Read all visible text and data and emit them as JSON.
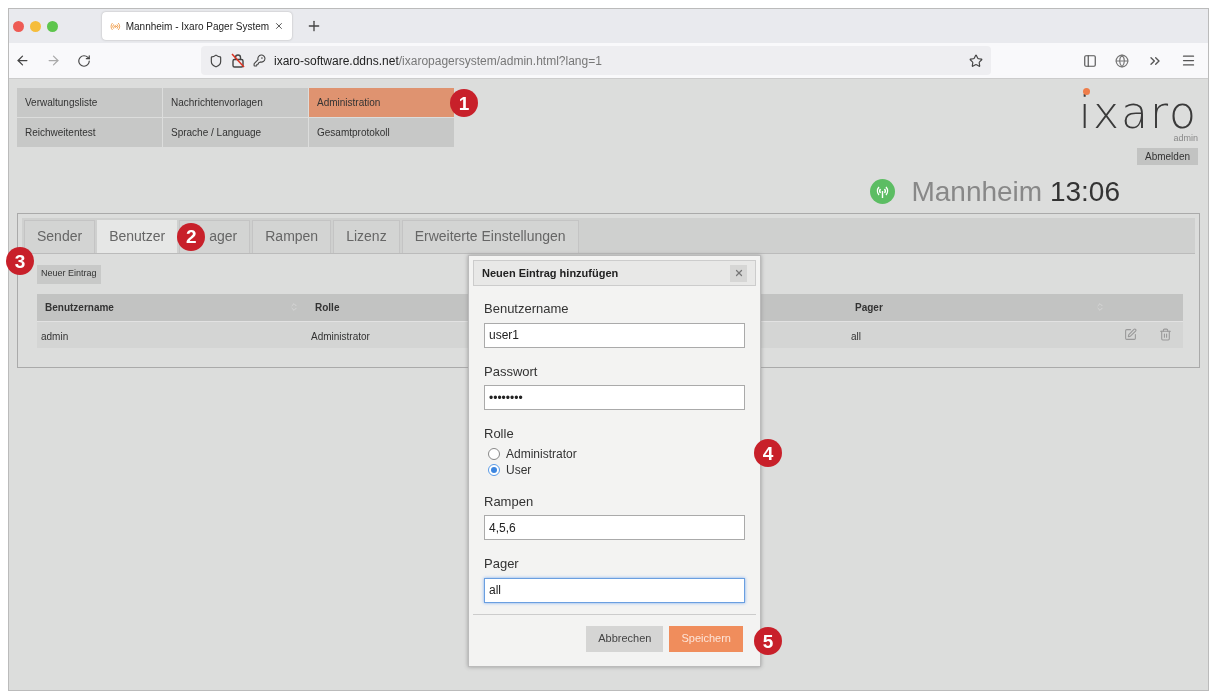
{
  "browser": {
    "tab_title": "Mannheim - Ixaro Pager System",
    "url_host": "ixaro-software.ddns.net",
    "url_path": "/ixaropagersystem/admin.html?lang=1"
  },
  "menu": [
    {
      "label": "Verwaltungsliste",
      "selected": false
    },
    {
      "label": "Nachrichtenvorlagen",
      "selected": false
    },
    {
      "label": "Administration",
      "selected": true
    },
    {
      "label": "Reichweitentest",
      "selected": false
    },
    {
      "label": "Sprache / Language",
      "selected": false
    },
    {
      "label": "Gesamtprotokoll",
      "selected": false
    }
  ],
  "logo": {
    "text": "ixaro",
    "role": "admin"
  },
  "logout": "Abmelden",
  "location": "Mannheim",
  "time": "13:06",
  "tabs": [
    {
      "label": "Sender",
      "selected": false
    },
    {
      "label": "Benutzer",
      "selected": true
    },
    {
      "label": "ager",
      "selected": false
    },
    {
      "label": "Rampen",
      "selected": false
    },
    {
      "label": "Lizenz",
      "selected": false
    },
    {
      "label": "Erweiterte Einstellungen",
      "selected": false
    }
  ],
  "new_entry": "Neuer Eintrag",
  "table": {
    "columns": [
      "Benutzername",
      "Rolle",
      "Pager"
    ],
    "rows": [
      {
        "cells": [
          "admin",
          "Administrator",
          "all"
        ]
      }
    ]
  },
  "dialog": {
    "title": "Neuen Eintrag hinzufügen",
    "fields": [
      {
        "kind": "text",
        "label": "Benutzername",
        "value": "user1",
        "focused": false
      },
      {
        "kind": "text",
        "label": "Passwort",
        "value": "••••••••",
        "focused": false
      },
      {
        "kind": "radio",
        "label": "Rolle",
        "options": [
          {
            "label": "Administrator",
            "selected": false
          },
          {
            "label": "User",
            "selected": true
          }
        ]
      },
      {
        "kind": "text",
        "label": "Rampen",
        "value": "4,5,6",
        "focused": false
      },
      {
        "kind": "text",
        "label": "Pager",
        "value": "all",
        "focused": true
      }
    ],
    "buttons": [
      {
        "label": "Abbrechen",
        "kind": "secondary"
      },
      {
        "label": "Speichern",
        "kind": "primary"
      }
    ]
  },
  "callouts": [
    "1",
    "2",
    "3",
    "4",
    "5"
  ]
}
